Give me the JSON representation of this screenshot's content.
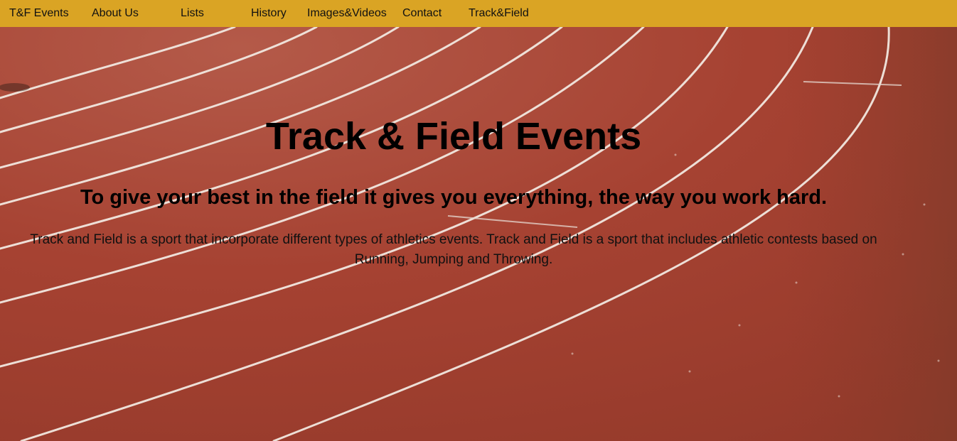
{
  "nav": {
    "items": [
      {
        "label": "T&F Events"
      },
      {
        "label": "About Us"
      },
      {
        "label": "Lists"
      },
      {
        "label": "History"
      },
      {
        "label": "Images&Videos"
      },
      {
        "label": "Contact"
      },
      {
        "label": "Track&Field"
      }
    ]
  },
  "hero": {
    "title": "Track & Field Events",
    "subtitle": "To give your best in the field it gives you everything, the way you work hard.",
    "description": "Track and Field is a sport that incorporate different types of athletics events. Track and Field is a sport that includes athletic contests based on Running, Jumping and Throwing."
  },
  "colors": {
    "navbar": "#daa424",
    "track": "#a6402f",
    "lane_lines": "#f2e8e0"
  }
}
